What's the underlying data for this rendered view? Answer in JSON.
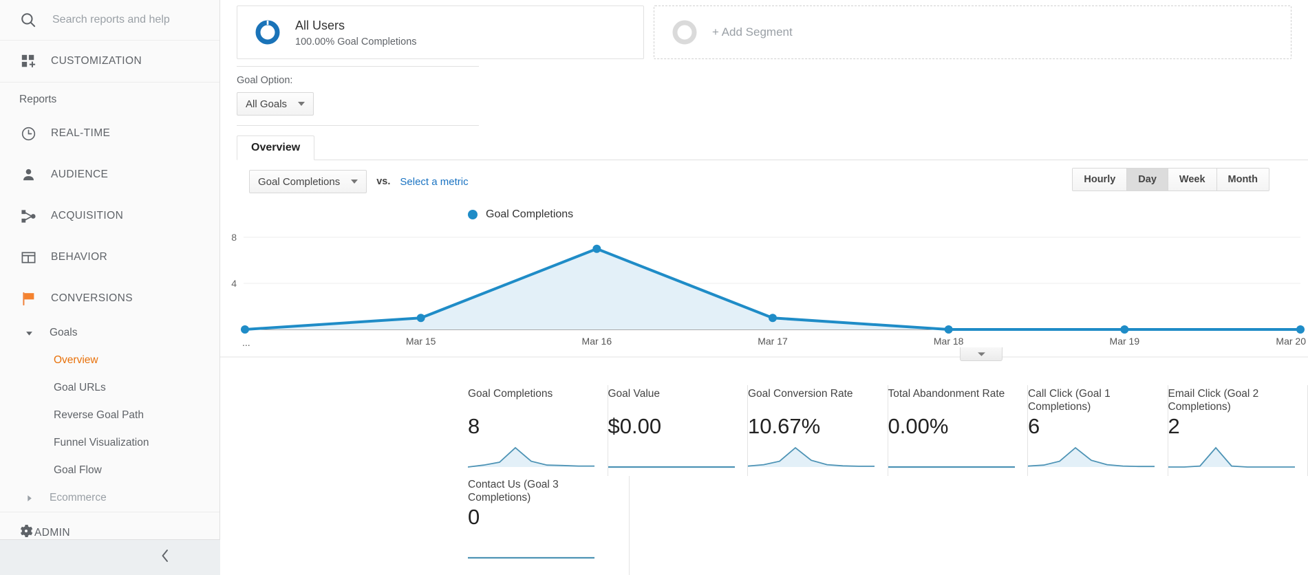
{
  "sidebar": {
    "search": {
      "placeholder": "Search reports and help",
      "icon": "search-icon"
    },
    "customization": {
      "label": "CUSTOMIZATION",
      "icon": "dashboard-plus-icon"
    },
    "reports_label": "Reports",
    "nav": [
      {
        "label": "REAL-TIME",
        "icon": "clock-icon"
      },
      {
        "label": "AUDIENCE",
        "icon": "person-icon"
      },
      {
        "label": "ACQUISITION",
        "icon": "share-nodes-icon"
      },
      {
        "label": "BEHAVIOR",
        "icon": "layout-icon"
      },
      {
        "label": "CONVERSIONS",
        "icon": "flag-icon"
      }
    ],
    "goals": {
      "label": "Goals",
      "expanded_icon": "triangle-down-icon",
      "items": [
        {
          "label": "Overview",
          "active": true
        },
        {
          "label": "Goal URLs",
          "active": false
        },
        {
          "label": "Reverse Goal Path",
          "active": false
        },
        {
          "label": "Funnel Visualization",
          "active": false
        },
        {
          "label": "Goal Flow",
          "active": false
        }
      ]
    },
    "ecommerce": {
      "label": "Ecommerce",
      "collapsed_icon": "triangle-right-icon"
    },
    "admin": {
      "label": "ADMIN",
      "icon": "gear-icon"
    },
    "collapse": {
      "icon": "chevron-left-icon"
    },
    "accent_color": "#e8710a"
  },
  "segments": {
    "primary": {
      "name": "All Users",
      "subtitle": "100.00% Goal Completions",
      "icon": "donut-icon",
      "color": "#1a73b8"
    },
    "add": {
      "label": "+ Add Segment",
      "icon": "donut-empty-icon"
    }
  },
  "goal_option": {
    "label": "Goal Option:",
    "selected": "All Goals",
    "caret_icon": "chevron-down-icon"
  },
  "tabs": [
    {
      "label": "Overview",
      "active": true
    }
  ],
  "metric_selector": {
    "primary": "Goal Completions",
    "caret_icon": "chevron-down-icon",
    "vs_label": "vs.",
    "secondary_link": "Select a metric"
  },
  "granularity": {
    "options": [
      "Hourly",
      "Day",
      "Week",
      "Month"
    ],
    "selected": "Day"
  },
  "chart_data": {
    "type": "area",
    "title": "Goal Completions",
    "legend": [
      "Goal Completions"
    ],
    "legend_position": "top-left",
    "series": [
      {
        "name": "Goal Completions",
        "values": [
          0,
          1,
          7,
          1,
          0,
          0,
          0
        ],
        "color": "#1f8cc7",
        "fill": "#e3f0f8"
      }
    ],
    "categories": [
      "...",
      "Mar 15",
      "Mar 16",
      "Mar 17",
      "Mar 18",
      "Mar 19",
      "Mar 20"
    ],
    "xlabel": "",
    "ylabel": "",
    "ytick_labels": [
      "8",
      "4"
    ],
    "yticks": [
      8,
      4
    ],
    "ylim": [
      0,
      8
    ],
    "grid": true,
    "first_tick_label": "..."
  },
  "chart_expander": {
    "icon": "triangle-down-icon"
  },
  "metric_cards": [
    {
      "caption": "Goal Completions",
      "value": "8",
      "spark": "peak",
      "spark_values": [
        0,
        0.1,
        0.25,
        1.0,
        0.3,
        0.1,
        0.08,
        0.05,
        0.05
      ]
    },
    {
      "caption": "Goal Value",
      "value": "$0.00",
      "spark": "flat",
      "spark_values": [
        0,
        0,
        0,
        0,
        0,
        0,
        0,
        0,
        0
      ]
    },
    {
      "caption": "Goal Conversion Rate",
      "value": "10.67%",
      "spark": "peak",
      "spark_values": [
        0.05,
        0.12,
        0.3,
        1.0,
        0.35,
        0.12,
        0.06,
        0.04,
        0.04
      ]
    },
    {
      "caption": "Total Abandonment Rate",
      "value": "0.00%",
      "spark": "flat",
      "spark_values": [
        0,
        0,
        0,
        0,
        0,
        0,
        0,
        0,
        0
      ]
    },
    {
      "caption": "Call Click (Goal 1 Completions)",
      "value": "6",
      "spark": "peak",
      "spark_values": [
        0.05,
        0.1,
        0.3,
        1.0,
        0.35,
        0.12,
        0.05,
        0.03,
        0.03
      ]
    },
    {
      "caption": "Email Click (Goal 2 Completions)",
      "value": "2",
      "spark": "peak",
      "spark_values": [
        0,
        0,
        0.05,
        1.0,
        0.05,
        0,
        0,
        0,
        0
      ]
    }
  ],
  "metric_cards_row2": [
    {
      "caption": "Contact Us (Goal 3 Completions)",
      "value": "0",
      "spark": "flat",
      "spark_values": [
        0,
        0,
        0,
        0,
        0,
        0,
        0,
        0,
        0
      ]
    }
  ],
  "colors": {
    "accent_orange": "#e8710a",
    "chart_blue": "#1f8cc7",
    "chart_fill": "#e3f0f8",
    "link_blue": "#1a73c2",
    "sidebar_bg": "#fafafa",
    "spark_blue": "#4d93b5"
  }
}
